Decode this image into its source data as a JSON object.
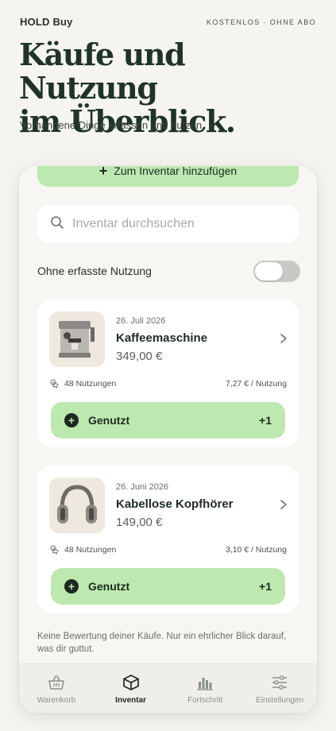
{
  "header": {
    "brand": "HOLD Buy",
    "tagline": "KOSTENLOS · OHNE ABO",
    "title_line1": "Käufe und Nutzung",
    "title_line2": "im Überblick.",
    "subtitle": "Vorhandene Dinge erfassen und nutzen."
  },
  "inventory": {
    "add_button_label": "Zum Inventar hinzufügen",
    "search_placeholder": "Inventar durchsuchen",
    "filter_label": "Ohne erfasste Nutzung",
    "filter_on": false,
    "items": [
      {
        "date": "26. Juli 2026",
        "name": "Kaffeemaschine",
        "price": "349,00 €",
        "uses": "48 Nutzungen",
        "cost_per_use": "7,27 € / Nutzung",
        "used_label": "Genutzt",
        "increment": "+1",
        "image_icon": "espresso-machine"
      },
      {
        "date": "26. Juni 2026",
        "name": "Kabellose Kopfhörer",
        "price": "149,00 €",
        "uses": "48 Nutzungen",
        "cost_per_use": "3,10 € / Nutzung",
        "used_label": "Genutzt",
        "increment": "+1",
        "image_icon": "headphones"
      }
    ],
    "footnote": "Keine Bewertung deiner Käufe. Nur ein ehrlicher Blick darauf, was dir guttut."
  },
  "tabbar": {
    "tabs": [
      {
        "label": "Warenkorb",
        "icon": "basket-icon",
        "active": false
      },
      {
        "label": "Inventar",
        "icon": "box-icon",
        "active": true
      },
      {
        "label": "Fortschritt",
        "icon": "bar-chart-icon",
        "active": false
      },
      {
        "label": "Einstellungen",
        "icon": "sliders-icon",
        "active": false
      }
    ]
  },
  "colors": {
    "accent_green": "#bde9b1",
    "text_dark": "#1d2a22",
    "background": "#f5f4f0"
  }
}
